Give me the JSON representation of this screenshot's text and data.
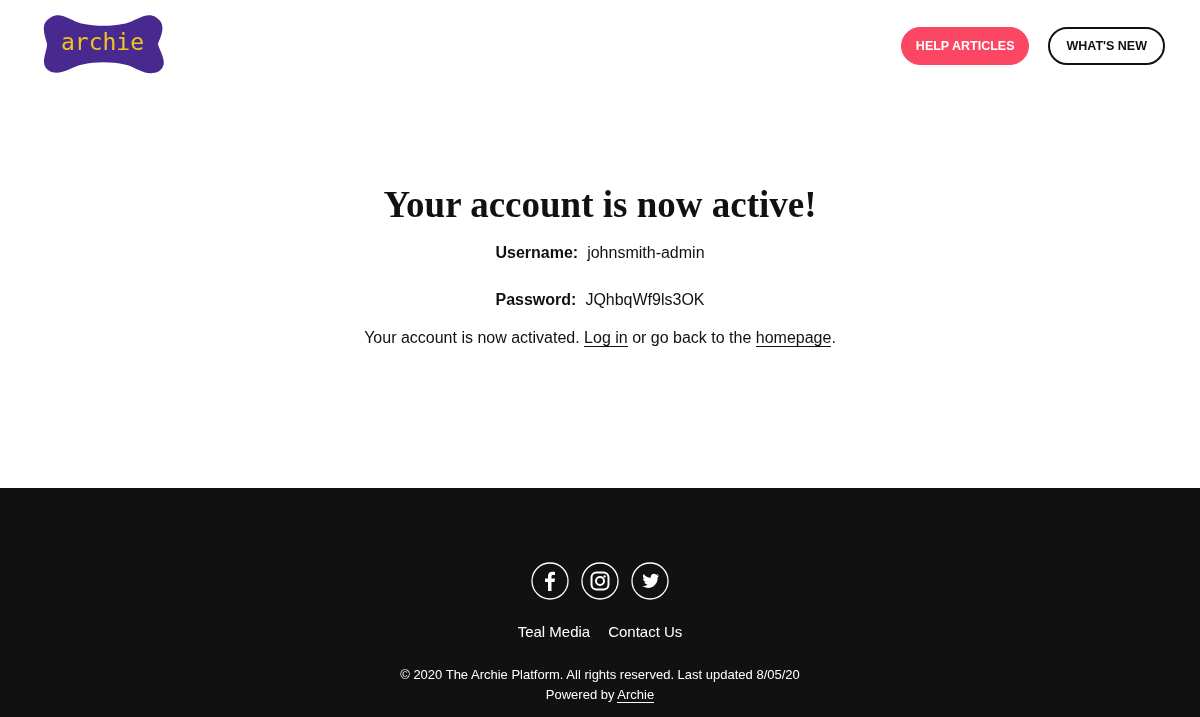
{
  "header": {
    "logo": "archie",
    "buttons": [
      {
        "label": "HELP ARTICLES",
        "kind": "primary"
      },
      {
        "label": "WHAT'S NEW",
        "kind": "outline"
      }
    ]
  },
  "main": {
    "title": "Your account is now active!",
    "fields": [
      {
        "label": "Username:",
        "value": "johnsmith-admin"
      },
      {
        "label": "Password:",
        "value": "JQhbqWf9ls3OK"
      }
    ],
    "message": [
      {
        "kind": "text",
        "text": "Your account is now activated. "
      },
      {
        "kind": "link",
        "text": "Log in"
      },
      {
        "kind": "text",
        "text": " or go back to the "
      },
      {
        "kind": "link",
        "text": "homepage"
      },
      {
        "kind": "text",
        "text": "."
      }
    ]
  },
  "footer": {
    "links": [
      "Teal Media",
      "Contact Us"
    ],
    "copyright": "© 2020 The Archie Platform. All rights reserved. Last updated 8/05/20",
    "powered": [
      {
        "kind": "text",
        "text": "Powered by "
      },
      {
        "kind": "link",
        "text": "Archie"
      }
    ]
  }
}
